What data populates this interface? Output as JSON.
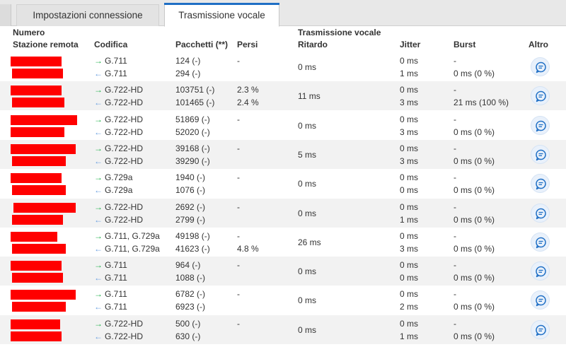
{
  "tabs": {
    "connection": "Impostazioni connessione",
    "voice": "Trasmissione vocale"
  },
  "headers": {
    "number": "Numero",
    "remote": "Stazione remota",
    "codec": "Codifica",
    "packets": "Pacchetti (**)",
    "lost": "Persi",
    "voice_group": "Trasmissione vocale",
    "delay": "Ritardo",
    "jitter": "Jitter",
    "burst": "Burst",
    "more": "Altro"
  },
  "icons": {
    "out": "right-arrow-icon",
    "in": "left-arrow-icon",
    "more": "chat-bubble-icon"
  },
  "colors": {
    "accent": "#1f6fc5",
    "redaction": "#ff0000",
    "arrow_out": "#21b24b",
    "arrow_in": "#6ba0e0"
  },
  "rows": [
    {
      "codec_out": "G.711",
      "codec_in": "G.711",
      "pkt_out": "124 (-)",
      "pkt_in": "294 (-)",
      "lost_out": "-",
      "lost_in": "",
      "delay": "0 ms",
      "jit_out": "0 ms",
      "jit_in": "1 ms",
      "burst_out": "-",
      "burst_in": "0 ms (0 %)"
    },
    {
      "codec_out": "G.722-HD",
      "codec_in": "G.722-HD",
      "pkt_out": "103751 (-)",
      "pkt_in": "101465 (-)",
      "lost_out": "2.3 %",
      "lost_in": "2.4 %",
      "delay": "11 ms",
      "jit_out": "0 ms",
      "jit_in": "3 ms",
      "burst_out": "-",
      "burst_in": "21 ms (100 %)"
    },
    {
      "codec_out": "G.722-HD",
      "codec_in": "G.722-HD",
      "pkt_out": "51869 (-)",
      "pkt_in": "52020 (-)",
      "lost_out": "-",
      "lost_in": "",
      "delay": "0 ms",
      "jit_out": "0 ms",
      "jit_in": "3 ms",
      "burst_out": "-",
      "burst_in": "0 ms (0 %)"
    },
    {
      "codec_out": "G.722-HD",
      "codec_in": "G.722-HD",
      "pkt_out": "39168 (-)",
      "pkt_in": "39290 (-)",
      "lost_out": "-",
      "lost_in": "",
      "delay": "5 ms",
      "jit_out": "0 ms",
      "jit_in": "3 ms",
      "burst_out": "-",
      "burst_in": "0 ms (0 %)"
    },
    {
      "codec_out": "G.729a",
      "codec_in": "G.729a",
      "pkt_out": "1940 (-)",
      "pkt_in": "1076 (-)",
      "lost_out": "-",
      "lost_in": "",
      "delay": "0 ms",
      "jit_out": "0 ms",
      "jit_in": "0 ms",
      "burst_out": "-",
      "burst_in": "0 ms (0 %)"
    },
    {
      "codec_out": "G.722-HD",
      "codec_in": "G.722-HD",
      "pkt_out": "2692 (-)",
      "pkt_in": "2799 (-)",
      "lost_out": "-",
      "lost_in": "",
      "delay": "0 ms",
      "jit_out": "0 ms",
      "jit_in": "1 ms",
      "burst_out": "-",
      "burst_in": "0 ms (0 %)"
    },
    {
      "codec_out": "G.711, G.729a",
      "codec_in": "G.711, G.729a",
      "pkt_out": "49198 (-)",
      "pkt_in": "41623 (-)",
      "lost_out": "-",
      "lost_in": "4.8 %",
      "delay": "26 ms",
      "jit_out": "0 ms",
      "jit_in": "3 ms",
      "burst_out": "-",
      "burst_in": "0 ms (0 %)"
    },
    {
      "codec_out": "G.711",
      "codec_in": "G.711",
      "pkt_out": "964 (-)",
      "pkt_in": "1088 (-)",
      "lost_out": "-",
      "lost_in": "",
      "delay": "0 ms",
      "jit_out": "0 ms",
      "jit_in": "0 ms",
      "burst_out": "-",
      "burst_in": "0 ms (0 %)"
    },
    {
      "codec_out": "G.711",
      "codec_in": "G.711",
      "pkt_out": "6782 (-)",
      "pkt_in": "6923 (-)",
      "lost_out": "-",
      "lost_in": "",
      "delay": "0 ms",
      "jit_out": "0 ms",
      "jit_in": "2 ms",
      "burst_out": "-",
      "burst_in": "0 ms (0 %)"
    },
    {
      "codec_out": "G.722-HD",
      "codec_in": "G.722-HD",
      "pkt_out": "500 (-)",
      "pkt_in": "630 (-)",
      "lost_out": "-",
      "lost_in": "",
      "delay": "0 ms",
      "jit_out": "0 ms",
      "jit_in": "1 ms",
      "burst_out": "-",
      "burst_in": "0 ms (0 %)"
    }
  ]
}
